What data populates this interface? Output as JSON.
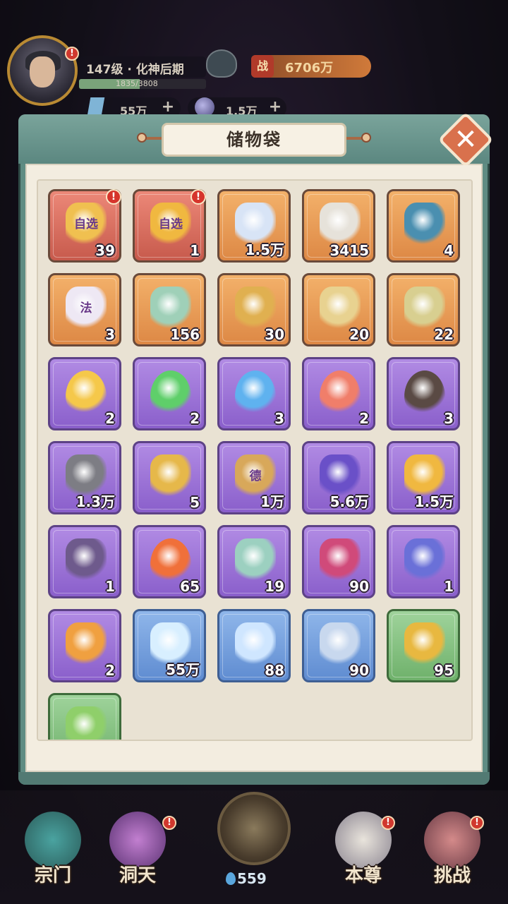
{
  "player": {
    "level_text": "147级 · 化神后期",
    "exp_text": "1835/3808",
    "exp_fraction": 0.48,
    "power_icon": "战",
    "power": "6706万",
    "currency_1": "55万",
    "currency_2": "1.5万",
    "plus": "+"
  },
  "panel": {
    "title": "储物袋",
    "close_icon": "✕"
  },
  "alert_mark": "!",
  "items": [
    {
      "icon": "red-envelope-scroll-icon",
      "rarity": "red",
      "count": "39",
      "label": "自选",
      "alert": true
    },
    {
      "icon": "golden-lion-chest-icon",
      "rarity": "red",
      "count": "1",
      "label": "自选",
      "alert": true
    },
    {
      "icon": "blue-swirl-orb-icon",
      "rarity": "orange",
      "count": "1.5万"
    },
    {
      "icon": "bone-claw-icon",
      "rarity": "orange",
      "count": "3415"
    },
    {
      "icon": "cyan-crystal-shard-icon",
      "rarity": "orange",
      "count": "4"
    },
    {
      "icon": "fa-talisman-icon",
      "rarity": "orange",
      "count": "3",
      "label": "法"
    },
    {
      "icon": "jade-lion-statue-icon",
      "rarity": "orange",
      "count": "156"
    },
    {
      "icon": "golden-bracelet-icon",
      "rarity": "orange",
      "count": "30"
    },
    {
      "icon": "golden-scroll-icon",
      "rarity": "orange",
      "count": "20"
    },
    {
      "icon": "jade-orb-scroll-icon",
      "rarity": "orange",
      "count": "22"
    },
    {
      "icon": "yellow-flame-icon",
      "rarity": "purple",
      "count": "2"
    },
    {
      "icon": "green-flame-icon",
      "rarity": "purple",
      "count": "2"
    },
    {
      "icon": "blue-flame-icon",
      "rarity": "purple",
      "count": "3"
    },
    {
      "icon": "red-flame-icon",
      "rarity": "purple",
      "count": "2"
    },
    {
      "icon": "black-flame-icon",
      "rarity": "purple",
      "count": "3"
    },
    {
      "icon": "grey-ore-icon",
      "rarity": "purple",
      "count": "1.3万"
    },
    {
      "icon": "golden-ore-icon",
      "rarity": "purple",
      "count": "5"
    },
    {
      "icon": "merit-token-icon",
      "rarity": "purple",
      "count": "1万",
      "label": "德"
    },
    {
      "icon": "purple-rune-orb-icon",
      "rarity": "purple",
      "count": "5.6万"
    },
    {
      "icon": "amber-crystal-icon",
      "rarity": "purple",
      "count": "1.5万"
    },
    {
      "icon": "purple-ring-icon",
      "rarity": "purple",
      "count": "1"
    },
    {
      "icon": "skull-flame-icon",
      "rarity": "purple",
      "count": "65"
    },
    {
      "icon": "jade-vase-icon",
      "rarity": "purple",
      "count": "19"
    },
    {
      "icon": "crimson-lotus-orb-icon",
      "rarity": "purple",
      "count": "90"
    },
    {
      "icon": "spirit-feather-icon",
      "rarity": "purple",
      "count": "1"
    },
    {
      "icon": "fire-amber-crystal-icon",
      "rarity": "purple",
      "count": "2"
    },
    {
      "icon": "ice-diamond-icon",
      "rarity": "blue",
      "count": "55万"
    },
    {
      "icon": "water-orb-icon",
      "rarity": "blue",
      "count": "88"
    },
    {
      "icon": "ice-shard-cluster-icon",
      "rarity": "blue",
      "count": "90"
    },
    {
      "icon": "dragon-gold-orb-icon",
      "rarity": "green",
      "count": "95"
    },
    {
      "icon": "herb-leaf-icon",
      "rarity": "green",
      "count": ""
    }
  ],
  "nav": {
    "sect": "宗门",
    "cave": "洞天",
    "center_count": "559",
    "self": "本尊",
    "challenge": "挑战"
  },
  "colors": {
    "panel_teal": "#5f8c83",
    "paper": "#f3ede0",
    "close": "#d9714d"
  }
}
